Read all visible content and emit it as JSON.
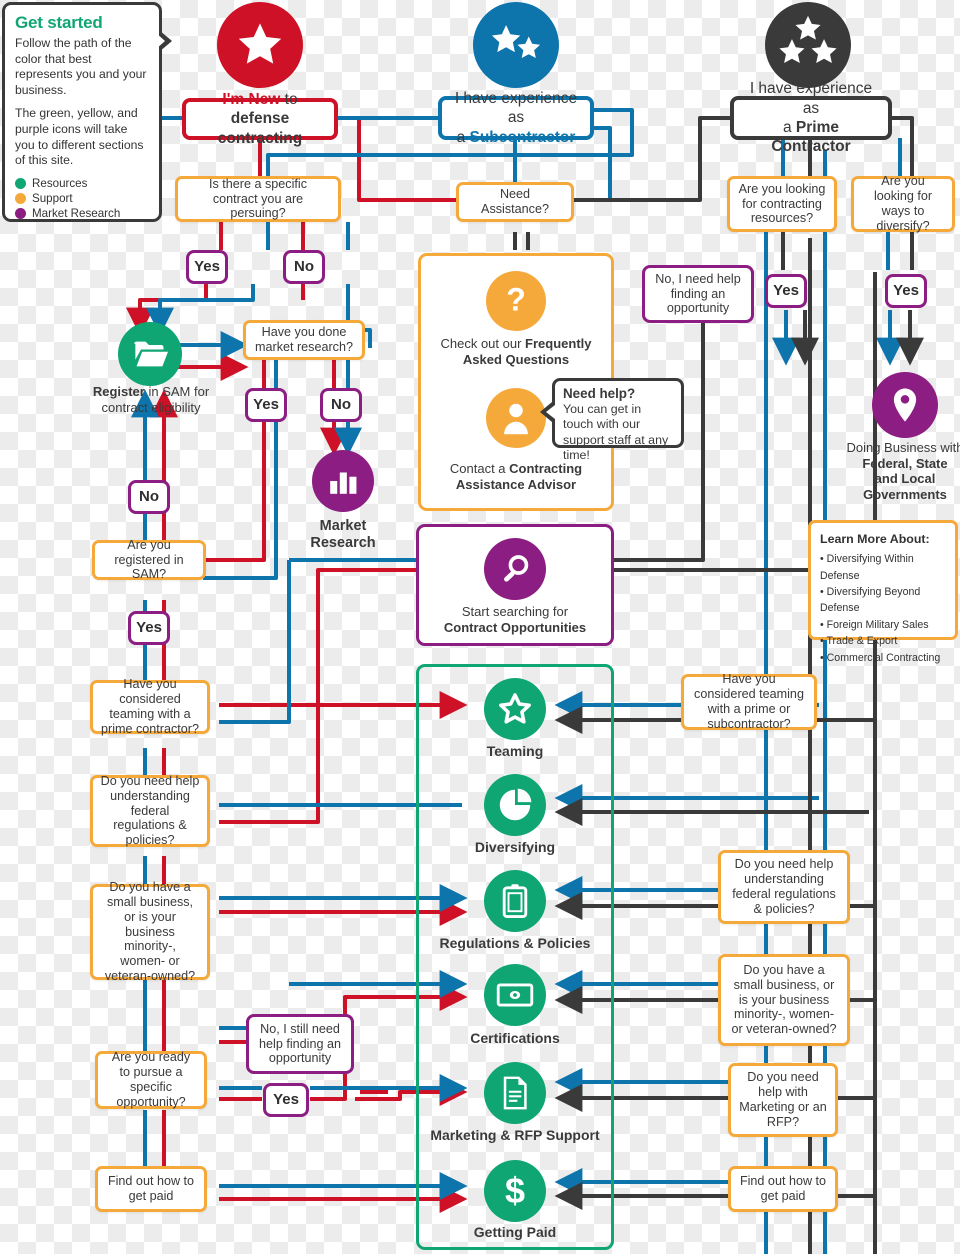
{
  "legend": {
    "title": "Get started",
    "p1": "Follow the path of the color that best represents you and your business.",
    "p2": "The green,  yellow, and purple icons will take you to different sections of this site.",
    "items": [
      {
        "label": "Resources",
        "color": "#10A674"
      },
      {
        "label": "Support",
        "color": "#F5A93B"
      },
      {
        "label": "Market Research",
        "color": "#8C1D82"
      }
    ]
  },
  "colors": {
    "red": "#CE1126",
    "blue": "#0E74AC",
    "dark": "#3A3A3A",
    "green": "#10A674",
    "orange": "#F5A93B",
    "purple": "#8C1D82"
  },
  "entry": {
    "new": {
      "lead": "I'm New",
      "rest": " to",
      "line2": "defense contracting",
      "icon": "one-star-icon",
      "color": "#CE1126"
    },
    "sub": {
      "line1": "I have experience as",
      "lead": "a ",
      "accent": "Subcontractor",
      "icon": "two-stars-icon",
      "color": "#0E74AC"
    },
    "prime": {
      "line1": "I have experience as",
      "lead": "a ",
      "accent": "Prime Contractor",
      "icon": "three-stars-icon",
      "color": "#3A3A3A"
    }
  },
  "questions": {
    "specific_contract": "Is there a specific contract you are persuing?",
    "need_assistance": "Need Assistance?",
    "looking_resources": "Are you looking for contracting resources?",
    "looking_diversify": "Are you looking for ways to diversify?",
    "market_research": "Have you done market research?",
    "registered_sam": "Are you registered in SAM?",
    "teaming_left": "Have you considered teaming with a prime contractor?",
    "regs_left": "Do you need help understanding federal regulations & policies?",
    "small_biz_left": "Do you have a small business, or is your business minority-, women- or veteran-owned?",
    "ready_pursue": "Are you ready to pursue a specific opportunity?",
    "get_paid_left": "Find out how to get paid",
    "teaming_right": "Have you considered teaming with a prime or subcontractor?",
    "regs_right": "Do you need help understanding federal regulations & policies?",
    "small_biz_right": "Do you have a small business, or is your business minority-, women- or veteran-owned?",
    "marketing_right": "Do you need help with Marketing or an RFP?",
    "get_paid_right": "Find out how to get paid"
  },
  "labels": {
    "yes": "Yes",
    "no": "No",
    "no_need_help_opportunity": "No, I need help finding an opportunity",
    "no_still_need_help": "No, I still need help finding an opportunity"
  },
  "panels": {
    "support": {
      "faq": {
        "pre": "Check out our ",
        "strong": "Frequently Asked Questions",
        "icon": "question-mark-icon"
      },
      "advisor": {
        "pre": "Contact a ",
        "strong": "Contracting Assistance Advisor",
        "icon": "person-icon"
      },
      "tooltip": {
        "title": "Need help?",
        "body": "You can get in touch with our support staff at any time!"
      }
    },
    "opportunities": {
      "pre": "Start searching for",
      "strong": "Contract Opportunities",
      "icon": "magnifier-icon"
    },
    "sam": {
      "strong": "Register",
      "rest": " in SAM for contract eligibility",
      "icon": "folder-icon"
    },
    "market_research": {
      "line1": "Market",
      "line2": "Research",
      "icon": "bar-chart-icon"
    },
    "doing_business": {
      "pre": "Doing Business with",
      "strong1": "Federal, State",
      "strong2": "and Local",
      "strong3": "Governments",
      "icon": "map-pin-icon"
    },
    "learn_more": {
      "title": "Learn More About:",
      "items": [
        "Diversifying Within Defense",
        "Diversifying Beyond Defense",
        "Foreign Military Sales",
        "Trade & Export",
        "Commercial Contracting"
      ]
    },
    "resources": [
      {
        "label": "Teaming",
        "icon": "star-outline-icon"
      },
      {
        "label": "Diversifying",
        "icon": "pie-chart-icon"
      },
      {
        "label": "Regulations & Policies",
        "icon": "clipboard-icon"
      },
      {
        "label": "Certifications",
        "icon": "money-icon"
      },
      {
        "label": "Marketing & RFP Support",
        "icon": "document-icon"
      },
      {
        "label": "Getting Paid",
        "icon": "dollar-icon"
      }
    ]
  }
}
